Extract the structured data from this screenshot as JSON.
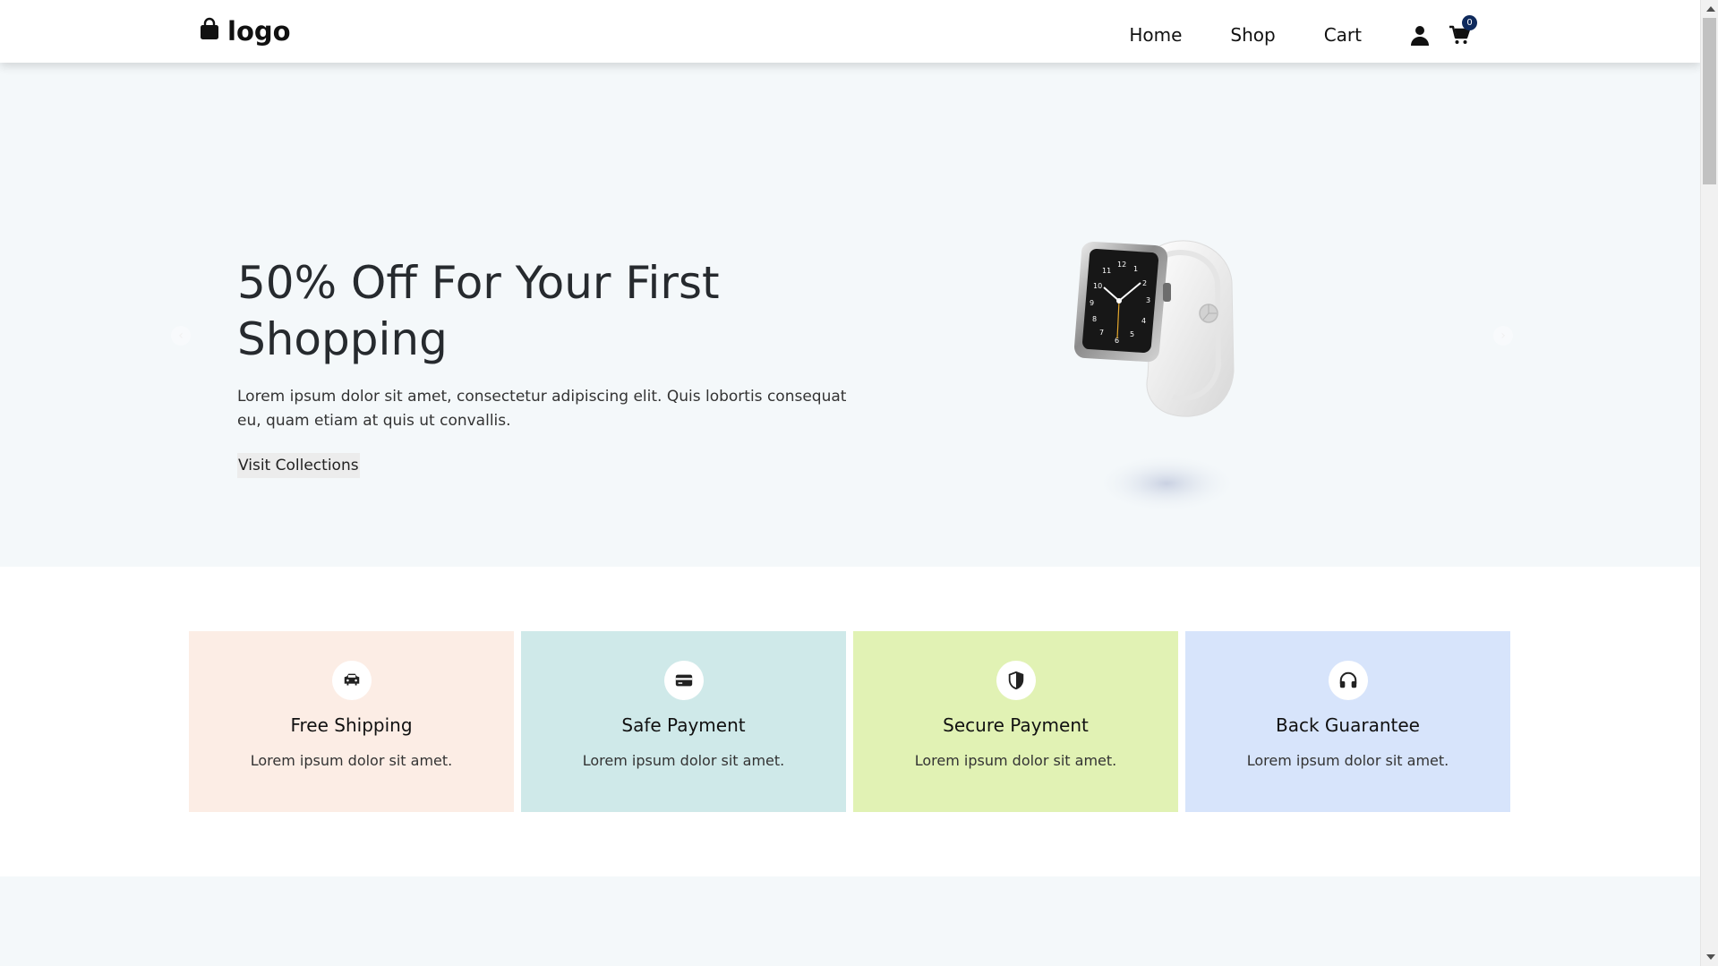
{
  "header": {
    "logo_text": "logo",
    "nav": [
      "Home",
      "Shop",
      "Cart"
    ],
    "cart_count": "0"
  },
  "hero": {
    "title": "50% Off For Your First Shopping",
    "text": "Lorem ipsum dolor sit amet, consectetur adipiscing elit. Quis lobortis consequat eu, quam etiam at quis ut convallis.",
    "button_label": "Visit Collections",
    "arrow_left": "‹",
    "arrow_right": "›"
  },
  "features": [
    {
      "title": "Free Shipping",
      "text": "Lorem ipsum dolor sit amet.",
      "icon": "car-icon",
      "color": "#fcede5"
    },
    {
      "title": "Safe Payment",
      "text": "Lorem ipsum dolor sit amet.",
      "icon": "credit-card-icon",
      "color": "#cfe9e9"
    },
    {
      "title": "Secure Payment",
      "text": "Lorem ipsum dolor sit amet.",
      "icon": "shield-icon",
      "color": "#e1f2b4"
    },
    {
      "title": "Back Guarantee",
      "text": "Lorem ipsum dolor sit amet.",
      "icon": "headphones-icon",
      "color": "#d7e4fb"
    }
  ],
  "colors": {
    "hero_background": "#f4f8fa",
    "badge": "#0f2a5c"
  }
}
